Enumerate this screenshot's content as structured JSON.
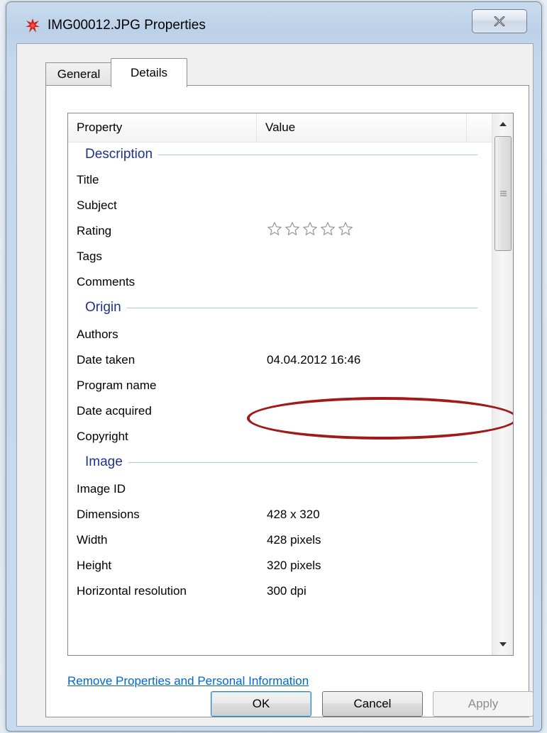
{
  "window": {
    "title": "IMG00012.JPG Properties",
    "icon": "red-splatter-icon",
    "close_glyph": "✕"
  },
  "tabs": [
    {
      "label": "General",
      "selected": false
    },
    {
      "label": "Details",
      "selected": true
    }
  ],
  "columns": {
    "property": "Property",
    "value": "Value"
  },
  "groups": {
    "description": "Description",
    "origin": "Origin",
    "image": "Image"
  },
  "rows": {
    "title": {
      "name": "Title",
      "value": ""
    },
    "subject": {
      "name": "Subject",
      "value": ""
    },
    "rating": {
      "name": "Rating",
      "stars": 0,
      "max_stars": 5
    },
    "tags": {
      "name": "Tags",
      "value": ""
    },
    "comments": {
      "name": "Comments",
      "value": ""
    },
    "authors": {
      "name": "Authors",
      "value": ""
    },
    "date_taken": {
      "name": "Date taken",
      "value": "04.04.2012 16:46"
    },
    "program_name": {
      "name": "Program name",
      "value": ""
    },
    "date_acquired": {
      "name": "Date acquired",
      "value": ""
    },
    "copyright": {
      "name": "Copyright",
      "value": ""
    },
    "image_id": {
      "name": "Image ID",
      "value": ""
    },
    "dimensions": {
      "name": "Dimensions",
      "value": "428 x 320"
    },
    "width": {
      "name": "Width",
      "value": "428 pixels"
    },
    "height": {
      "name": "Height",
      "value": "320 pixels"
    },
    "horizontal_resolution": {
      "name": "Horizontal resolution",
      "value": "300 dpi"
    }
  },
  "link": "Remove Properties and Personal Information",
  "buttons": {
    "ok": "OK",
    "cancel": "Cancel",
    "apply": "Apply"
  },
  "colors": {
    "annotation": "#a11a1a",
    "link": "#0066cc",
    "group_label": "#1e3287"
  }
}
